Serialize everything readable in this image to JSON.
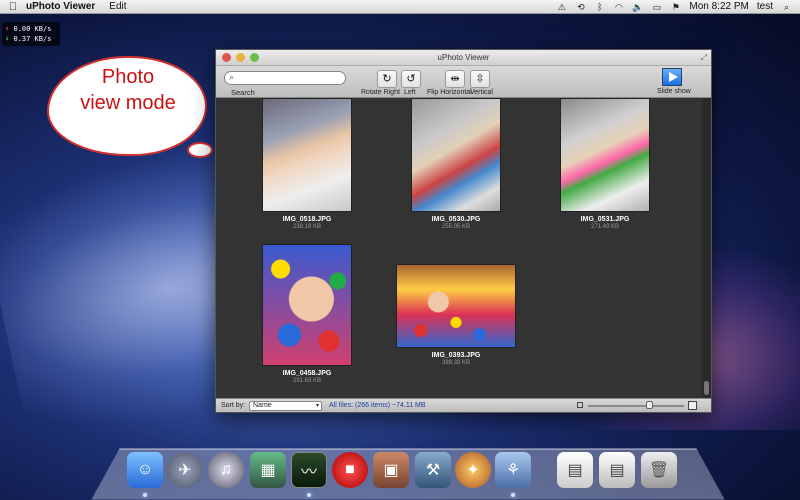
{
  "menubar": {
    "app_name": "uPhoto Viewer",
    "menus": [
      "Edit"
    ],
    "clock": "Mon 8:22 PM",
    "user": "test"
  },
  "netmon": {
    "up": "0.00 KB/s",
    "down": "0.37 KB/s"
  },
  "callout": {
    "line1": "Photo",
    "line2": "view mode"
  },
  "window": {
    "title": "uPhoto Viewer",
    "toolbar": {
      "search_label": "Search",
      "search_placeholder": "",
      "rotate_right": "Rotate Right",
      "rotate_left": "Left",
      "flip_horizontal": "Flip Horizontal",
      "flip_vertical": "Vertical",
      "slideshow": "Slide show"
    },
    "photos": [
      {
        "name": "IMG_0518.JPG",
        "size": "238.18 KB"
      },
      {
        "name": "IMG_0530.JPG",
        "size": "255.05 KB"
      },
      {
        "name": "IMG_0531.JPG",
        "size": "271.49 KB"
      },
      {
        "name": "IMG_0458.JPG",
        "size": "291.63 KB"
      },
      {
        "name": "IMG_0393.JPG",
        "size": "389.38 KB"
      }
    ],
    "status": {
      "sort_label": "Sort by:",
      "sort_value": "Name",
      "summary": "All files: (266 items) ~74.11 MB"
    }
  },
  "dock": {
    "icons": [
      "finder-icon",
      "launchpad-icon",
      "itunes-icon",
      "app-icon",
      "activity-monitor-icon",
      "video-icon",
      "preview-icon",
      "xcode-icon",
      "app-pro-icon",
      "photo-icon",
      "documents-stack-icon",
      "downloads-stack-icon",
      "trash-icon"
    ]
  }
}
